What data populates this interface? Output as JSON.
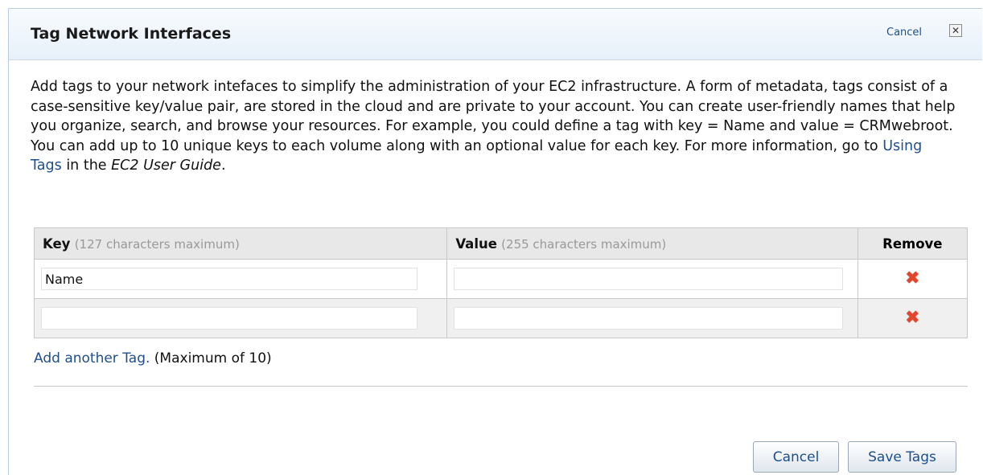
{
  "dialog": {
    "title": "Tag Network Interfaces",
    "cancel_link": "Cancel",
    "close_glyph": "✕"
  },
  "description": {
    "part1": "Add tags to your network intefaces to simplify the administration of your EC2 infrastructure. A form of metadata, tags consist of a case-sensitive key/value pair, are stored in the cloud and are private to your account. You can create user-friendly names that help you organize, search, and browse your resources. For example, you could define a tag with key = Name and value = CRMwebroot. You can add up to 10 unique keys to each volume along with an optional value for each key. For more information, go to ",
    "link": "Using Tags",
    "part2": " in the ",
    "guide": "EC2 User Guide",
    "part3": "."
  },
  "table": {
    "key_header": "Key",
    "key_hint": "(127 characters maximum)",
    "value_header": "Value",
    "value_hint": "(255 characters maximum)",
    "remove_header": "Remove",
    "rows": [
      {
        "key": "Name",
        "value": ""
      },
      {
        "key": "",
        "value": ""
      }
    ],
    "remove_icon": "remove-x-icon"
  },
  "add_tag": {
    "link": "Add another Tag.",
    "note": " (Maximum of 10)"
  },
  "buttons": {
    "cancel": "Cancel",
    "save": "Save Tags"
  },
  "colors": {
    "link": "#1e4f8c",
    "remove_icon": "#e2452b"
  }
}
